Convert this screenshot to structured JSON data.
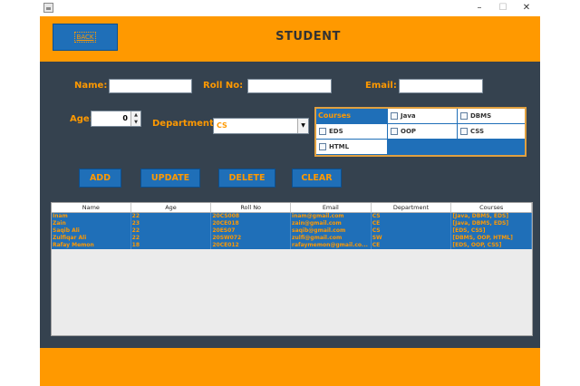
{
  "window": {
    "min_glyph": "–",
    "max_glyph": "☐",
    "close_glyph": "✕"
  },
  "header": {
    "back_label": "BACK",
    "title": "STUDENT"
  },
  "form": {
    "name_label": "Name:",
    "name_value": "",
    "rollno_label": "Roll No:",
    "rollno_value": "",
    "email_label": "Email:",
    "email_value": "",
    "age_label": "Age:",
    "age_value": "0",
    "department_label": "Department:",
    "department_value": "CS",
    "courses": {
      "title": "Courses",
      "options": [
        "Java",
        "DBMS",
        "EDS",
        "OOP",
        "CSS",
        "HTML"
      ]
    }
  },
  "buttons": {
    "add": "ADD",
    "update": "UPDATE",
    "delete": "DELETE",
    "clear": "CLEAR"
  },
  "table": {
    "columns": [
      "Name",
      "Age",
      "Roll No",
      "Email",
      "Department",
      "Courses"
    ],
    "rows": [
      [
        "Inam",
        "22",
        "20CS008",
        "inam@gmail.com",
        "CS",
        "[Java, DBMS, EDS]"
      ],
      [
        "Zain",
        "23",
        "20CE018",
        "zain@gmail.com",
        "CE",
        "[Java, DBMS, EDS]"
      ],
      [
        "Saqib Ali",
        "22",
        "20ES07",
        "saqib@gmail.com",
        "CS",
        "[EDS, CSS]"
      ],
      [
        "Zulfiqar Ali",
        "22",
        "20SW072",
        "zulfi@gmail.com",
        "SW",
        "[DBMS, OOP, HTML]"
      ],
      [
        "Rafay Memon",
        "18",
        "20CE012",
        "rafaymemon@gmail.co...",
        "CE",
        "[EDS, OOP, CSS]"
      ]
    ]
  },
  "colors": {
    "accent": "#ff9900",
    "panel": "#35424f",
    "selection": "#1f6fb8"
  }
}
